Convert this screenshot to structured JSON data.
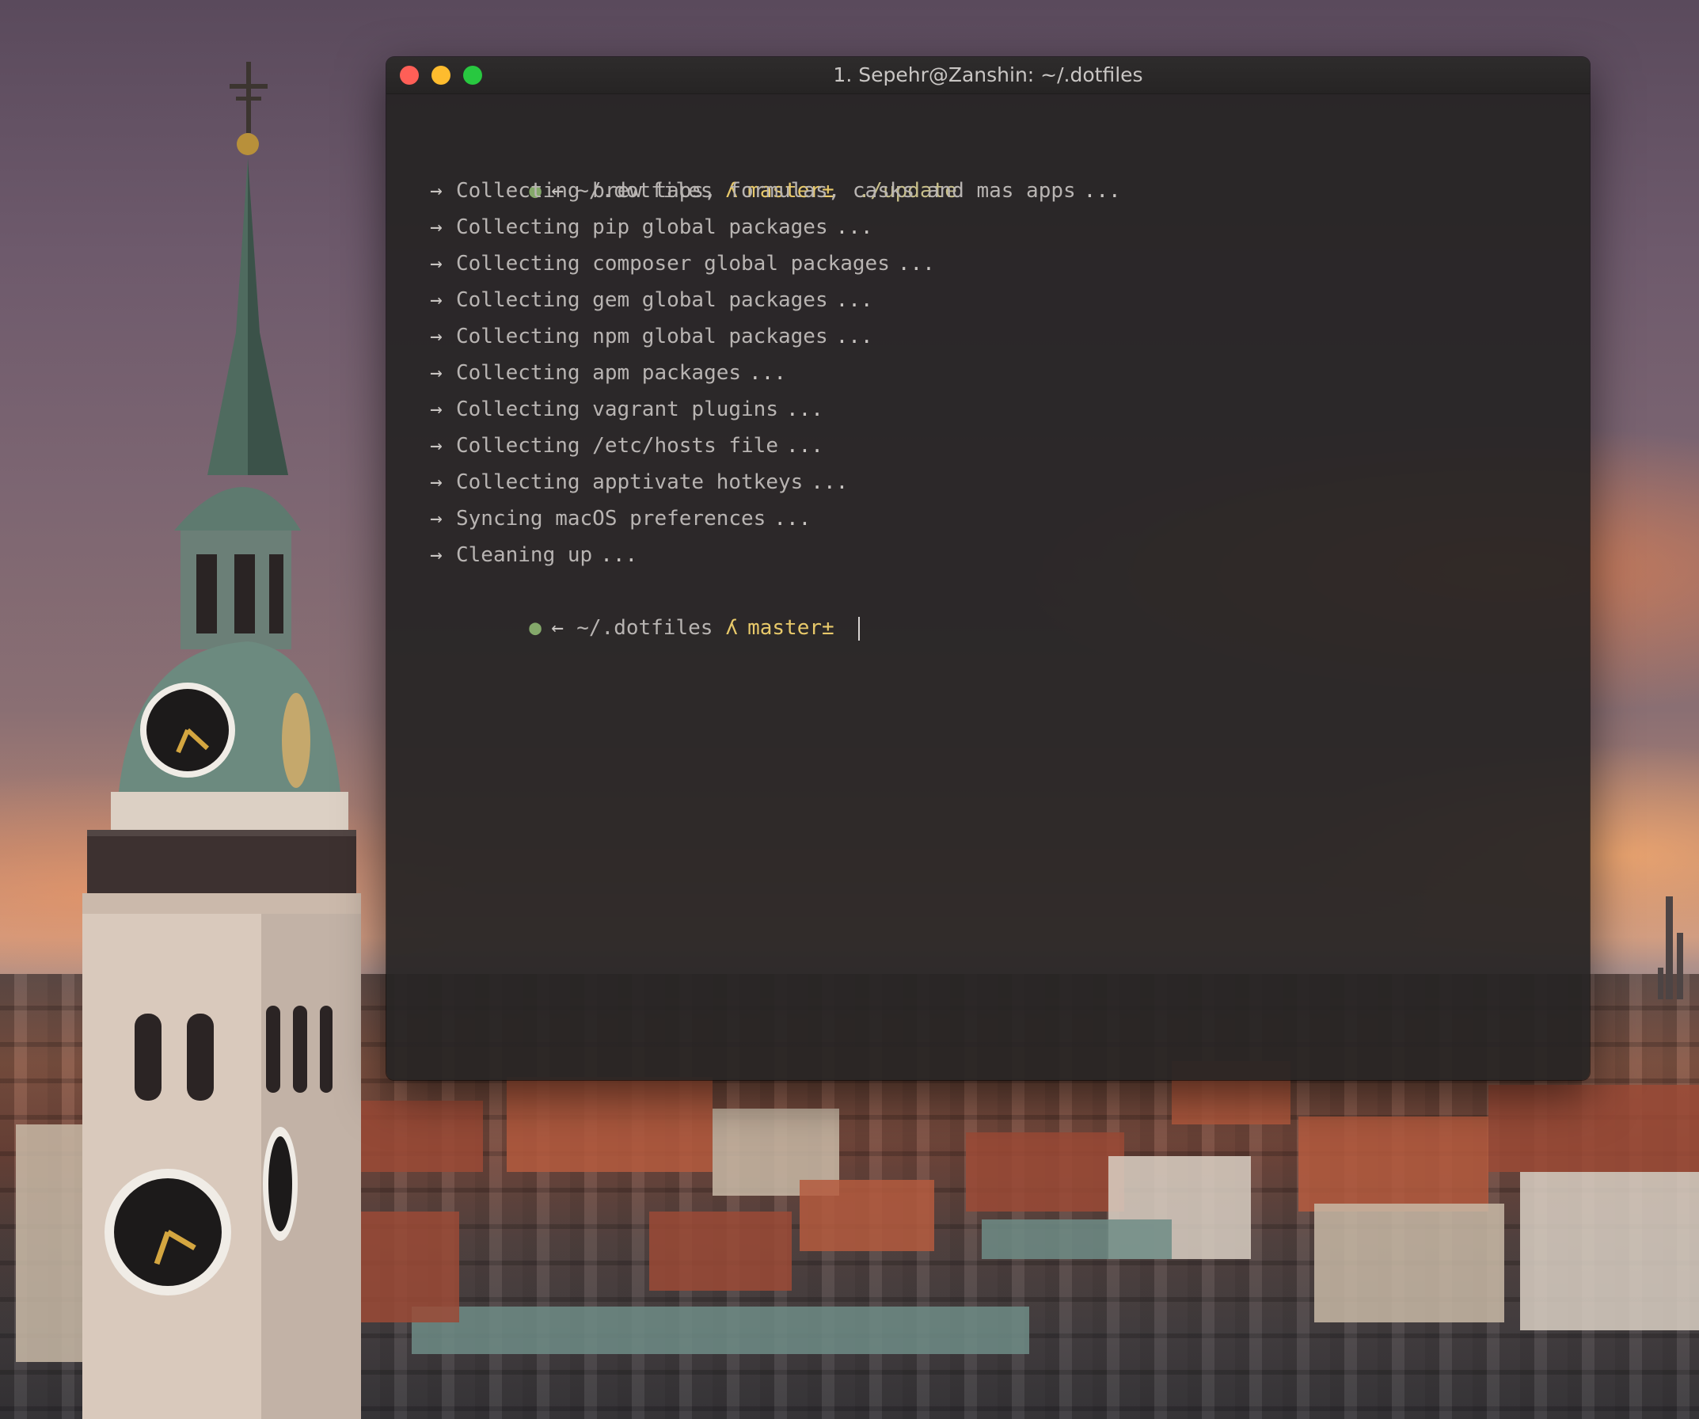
{
  "window": {
    "title": "1. Sepehr@Zanshin: ~/.dotfiles",
    "traffic_lights": {
      "close_color": "#ff5f57",
      "minimize_color": "#febc2e",
      "zoom_color": "#28c840"
    }
  },
  "prompt": {
    "path": "~/.dotfiles",
    "branch_icon": "ʎ",
    "branch": "master±",
    "dot_icon": "●",
    "back_icon": "←"
  },
  "first_command": "./update",
  "output_lines": [
    {
      "text": "Collecting brew taps, formulas, casks and mas apps",
      "suffix": "..."
    },
    {
      "text": "Collecting pip global packages",
      "suffix": "..."
    },
    {
      "text": "Collecting composer global packages",
      "suffix": "..."
    },
    {
      "text": "Collecting gem global packages",
      "suffix": "..."
    },
    {
      "text": "Collecting npm global packages",
      "suffix": "..."
    },
    {
      "text": "Collecting apm packages",
      "suffix": "..."
    },
    {
      "text": "Collecting vagrant plugins",
      "suffix": "..."
    },
    {
      "text": "Collecting /etc/hosts file",
      "suffix": "..."
    },
    {
      "text": "Collecting apptivate hotkeys",
      "suffix": "..."
    },
    {
      "text": "Syncing macOS preferences",
      "suffix": "..."
    },
    {
      "text": "Cleaning up",
      "suffix": "..."
    }
  ],
  "arrow_icon": "→",
  "colors": {
    "prompt_dot": "#84a86a",
    "branch": "#e8c96a",
    "command": "#c8bf8a",
    "text": "#b8b4b2"
  }
}
